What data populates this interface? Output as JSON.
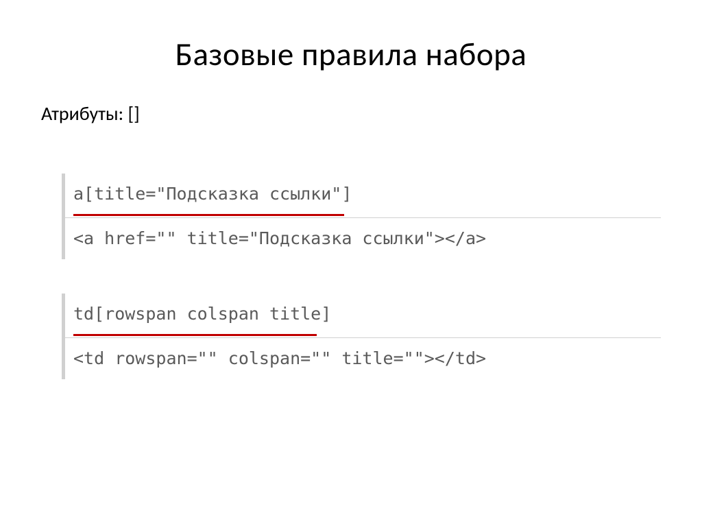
{
  "title": "Базовые правила набора",
  "subtitle": "Атрибуты: []",
  "blocks": [
    {
      "source": "a[title=\"Подсказка ссылки\"]",
      "result": "<a href=\"\" title=\"Подсказка ссылки\"></a>"
    },
    {
      "source": "td[rowspan colspan title]",
      "result": "<td rowspan=\"\" colspan=\"\" title=\"\"></td>"
    }
  ]
}
